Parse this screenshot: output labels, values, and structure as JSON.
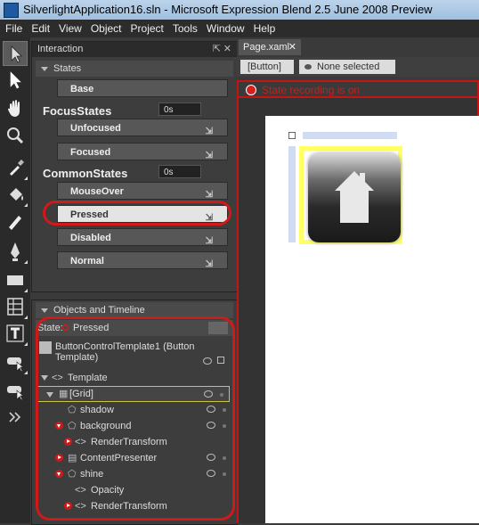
{
  "window": {
    "title": "SilverlightApplication16.sln - Microsoft Expression Blend 2.5 June 2008 Preview"
  },
  "menu": [
    "File",
    "Edit",
    "View",
    "Object",
    "Project",
    "Tools",
    "Window",
    "Help"
  ],
  "tools": [
    {
      "name": "selection-arrow-icon",
      "selected": true
    },
    {
      "name": "direct-selection-icon"
    },
    {
      "name": "pan-hand-icon"
    },
    {
      "name": "zoom-icon"
    },
    {
      "name": "eyedropper-icon"
    },
    {
      "name": "paint-bucket-icon"
    },
    {
      "name": "brush-transform-icon"
    },
    {
      "name": "pen-icon"
    },
    {
      "name": "rectangle-icon"
    },
    {
      "name": "grid-layout-icon"
    },
    {
      "name": "text-icon"
    },
    {
      "name": "button-control-icon"
    },
    {
      "name": "asset-control-icon"
    },
    {
      "name": "more-tools-icon"
    }
  ],
  "interaction": {
    "title": "Interaction",
    "states_label": "States",
    "base": "Base",
    "groups": [
      {
        "name": "FocusStates",
        "time": "0s",
        "states": [
          "Unfocused",
          "Focused"
        ]
      },
      {
        "name": "CommonStates",
        "time": "0s",
        "states": [
          "MouseOver",
          "Pressed",
          "Disabled",
          "Normal"
        ]
      }
    ],
    "selected_state": "Pressed"
  },
  "objects": {
    "title": "Objects and Timeline",
    "state_label": "State:",
    "state_value": "Pressed",
    "template_name": "ButtonControlTemplate1 (Button Template)",
    "rows": [
      {
        "label": "Template",
        "indent": 0
      },
      {
        "label": "[Grid]",
        "indent": 1
      },
      {
        "label": "shadow",
        "indent": 2
      },
      {
        "label": "background",
        "indent": 2
      },
      {
        "label": "RenderTransform",
        "indent": 3
      },
      {
        "label": "ContentPresenter",
        "indent": 2
      },
      {
        "label": "shine",
        "indent": 2
      },
      {
        "label": "Opacity",
        "indent": 3
      },
      {
        "label": "RenderTransform",
        "indent": 3
      }
    ]
  },
  "document": {
    "tab": "Page.xaml",
    "crumb_element": "[Button]",
    "crumb_none": "None selected",
    "recording": "State recording is on"
  },
  "colors": {
    "recording": "#c41515",
    "accent_yellow": "#ffff66",
    "selection_blue": "#cfdcf2"
  }
}
